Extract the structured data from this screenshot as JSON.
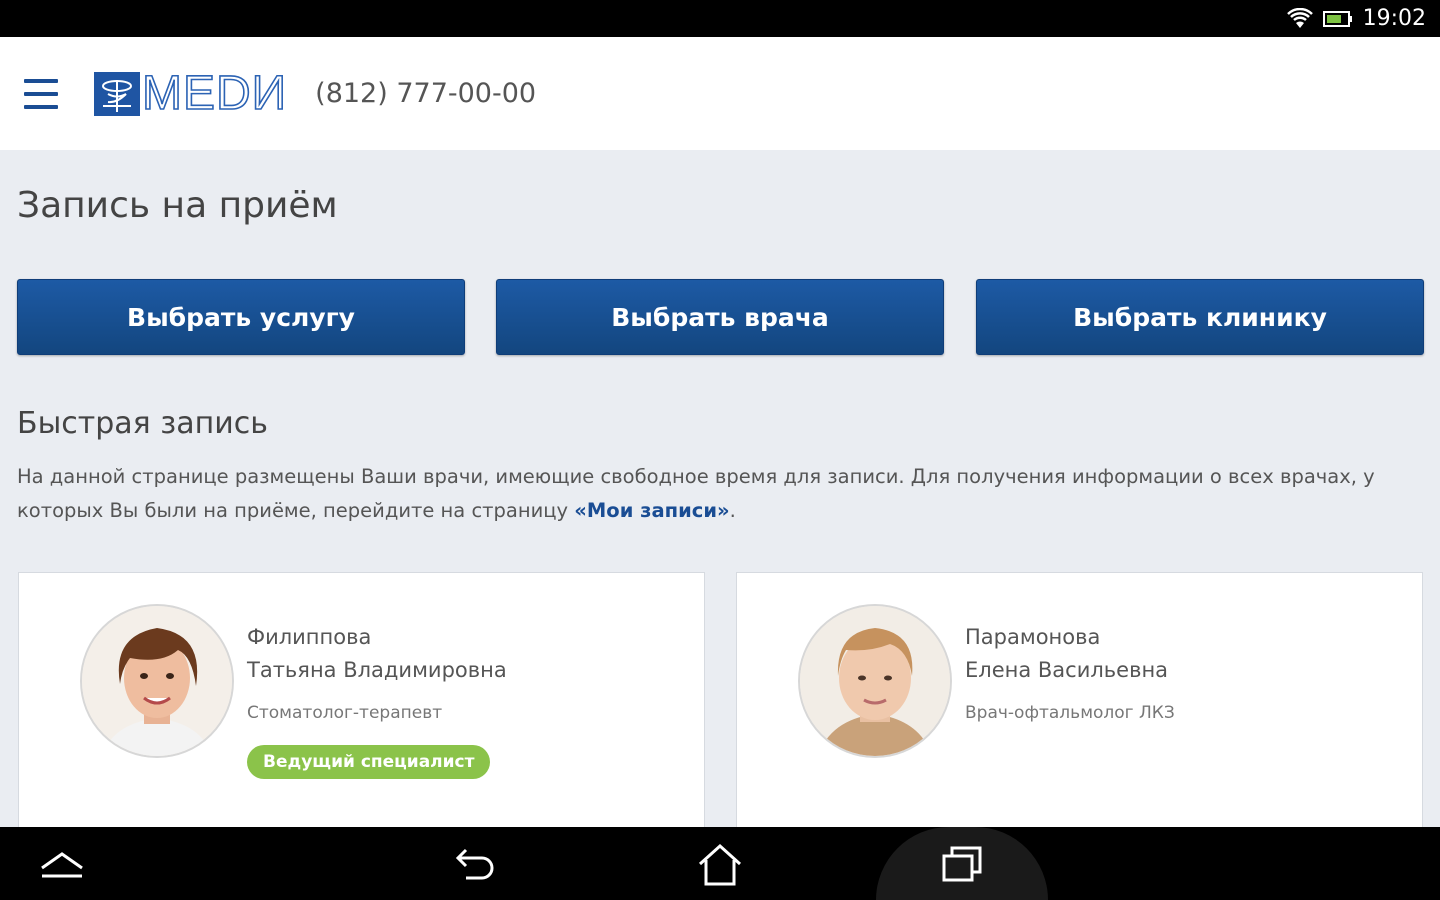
{
  "status_bar": {
    "time": "19:02",
    "wifi_icon": "wifi-icon",
    "battery_icon": "battery-icon"
  },
  "header": {
    "menu_icon": "hamburger-menu-icon",
    "logo_text": "МЕDИ",
    "phone": "(812) 777-00-00"
  },
  "main": {
    "title": "Запись на приём",
    "buttons": [
      {
        "label": "Выбрать услугу"
      },
      {
        "label": "Выбрать врача"
      },
      {
        "label": "Выбрать клинику"
      }
    ],
    "quick": {
      "title": "Быстрая запись",
      "description_start": "На данной странице размещены Ваши врачи, имеющие свободное время для записи. Для получения информации о всех врачах, у которых Вы были на приёме, перейдите на страницу ",
      "link_text": "«Мои записи»",
      "description_end": "."
    },
    "doctors": [
      {
        "last_name": "Филиппова",
        "first_names": "Татьяна Владимировна",
        "specialty": "Стоматолог-терапевт",
        "badge": "Ведущий специалист"
      },
      {
        "last_name": "Парамонова",
        "first_names": "Елена Васильевна",
        "specialty": "Врач-офтальмолог ЛКЗ",
        "badge": ""
      }
    ]
  },
  "nav_bar": {
    "icons": [
      "expand-icon",
      "back-icon",
      "home-icon",
      "recent-apps-icon"
    ]
  },
  "colors": {
    "brand_blue": "#174f96",
    "badge_green": "#8bc34a",
    "page_bg": "#eaedf2",
    "link_blue": "#1a4d94"
  }
}
